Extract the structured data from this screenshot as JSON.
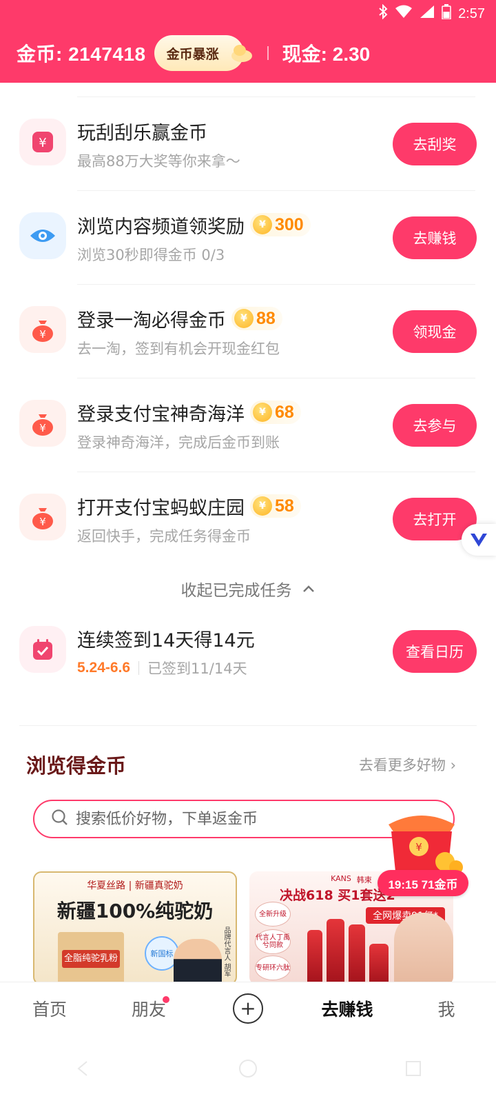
{
  "status_bar": {
    "time": "2:57"
  },
  "header": {
    "coins_label": "金币: 2147418",
    "surge_badge": "金币暴涨",
    "cash_label": "现金: 2.30"
  },
  "tasks": [
    {
      "title": "玩刮刮乐赢金币",
      "coins": "",
      "subtitle": "最高88万大奖等你来拿～",
      "button": "去刮奖",
      "icon": "scratch-card-icon",
      "icon_color": "#f0456f"
    },
    {
      "title": "浏览内容频道领奖励",
      "coins": "300",
      "subtitle": "浏览30秒即得金币 0/3",
      "button": "去赚钱",
      "icon": "eye-icon",
      "icon_color": "#3d9bf2"
    },
    {
      "title": "登录一淘必得金币",
      "coins": "88",
      "subtitle": "去一淘，签到有机会开现金红包",
      "button": "领现金",
      "icon": "money-bag-icon",
      "icon_color": "#ff5a4a"
    },
    {
      "title": "登录支付宝神奇海洋",
      "coins": "68",
      "subtitle": "登录神奇海洋，完成后金币到账",
      "button": "去参与",
      "icon": "money-bag-icon",
      "icon_color": "#ff5a4a"
    },
    {
      "title": "打开支付宝蚂蚁庄园",
      "coins": "58",
      "subtitle": "返回快手，完成任务得金币",
      "button": "去打开",
      "icon": "money-bag-icon",
      "icon_color": "#ff5a4a"
    }
  ],
  "collapse_label": "收起已完成任务",
  "signin": {
    "title": "连续签到14天得14元",
    "date_range": "5.24-6.6",
    "progress": "已签到11/14天",
    "button": "查看日历"
  },
  "browse": {
    "title": "浏览得金币",
    "more": "去看更多好物 ›",
    "search_placeholder": "搜索低价好物，下单返金币"
  },
  "floater": {
    "timer": "19:15 71金币"
  },
  "products": [
    {
      "brand": "华夏丝路 | 新疆真驼奶",
      "headline": "新疆100%纯驼奶",
      "pack_label": "全脂纯驼乳粉",
      "std_badge": "新国标",
      "spokes": "品牌代言人 胡军"
    },
    {
      "brand_top": [
        "KANS",
        "韩束"
      ],
      "headline": "决战618 买1套送2",
      "banner": "全网爆卖91亿*",
      "tags": [
        "全新升级",
        "代言人丁禹兮同款",
        "专研环六肽"
      ]
    }
  ],
  "bottom_nav": [
    {
      "label": "首页",
      "active": false
    },
    {
      "label": "朋友",
      "active": false
    },
    {
      "label": "",
      "active": false
    },
    {
      "label": "去赚钱",
      "active": true
    },
    {
      "label": "我",
      "active": false
    }
  ],
  "colors": {
    "brand": "#fe3a6a",
    "coin": "#ff8a00",
    "date": "#ff7a2a"
  }
}
